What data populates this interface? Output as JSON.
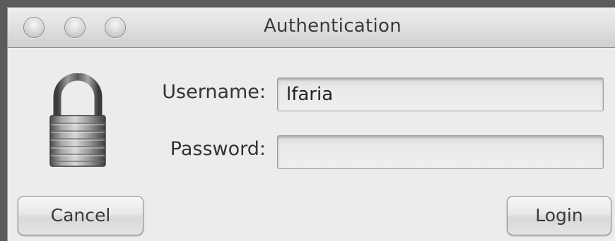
{
  "window": {
    "title": "Authentication"
  },
  "form": {
    "username_label": "Username:",
    "username_value": "lfaria",
    "password_label": "Password:",
    "password_value": ""
  },
  "buttons": {
    "cancel_label": "Cancel",
    "login_label": "Login"
  },
  "icons": {
    "close": "close-icon",
    "minimize": "minimize-icon",
    "zoom": "zoom-icon",
    "lock": "padlock-icon"
  }
}
